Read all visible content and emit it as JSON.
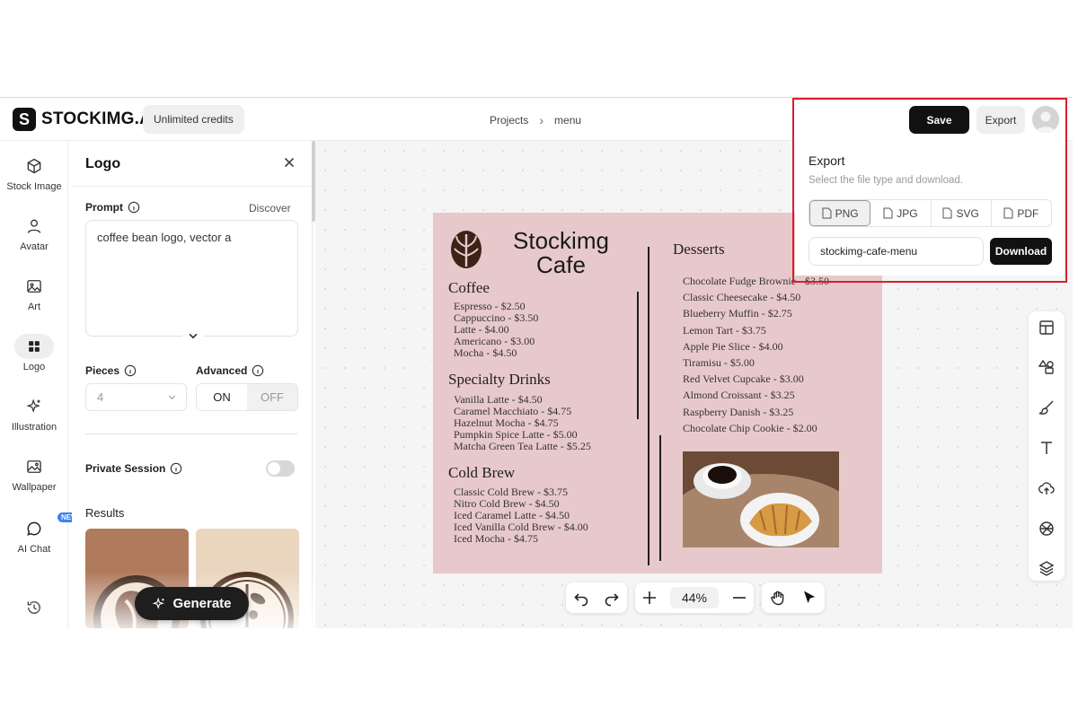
{
  "header": {
    "brand": "STOCKIMG.AI",
    "credits": "Unlimited credits",
    "breadcrumb": [
      "Projects",
      "menu"
    ],
    "save_label": "Save",
    "export_label": "Export"
  },
  "leftnav": {
    "items": [
      {
        "label": "Stock Image",
        "icon": "cube-icon"
      },
      {
        "label": "Avatar",
        "icon": "person-icon"
      },
      {
        "label": "Art",
        "icon": "image-icon"
      },
      {
        "label": "Logo",
        "icon": "grid-icon",
        "active": true
      },
      {
        "label": "Illustration",
        "icon": "sparkle-icon"
      },
      {
        "label": "Wallpaper",
        "icon": "wallpaper-icon"
      },
      {
        "label": "AI Chat",
        "icon": "chat-icon",
        "badge": "NEW"
      }
    ],
    "history_icon": "history-icon"
  },
  "panel": {
    "title": "Logo",
    "prompt_label": "Prompt",
    "discover": "Discover",
    "prompt_value": "coffee bean logo, vector a",
    "pieces_label": "Pieces",
    "pieces_value": "4",
    "advanced_label": "Advanced",
    "advanced_on": "ON",
    "advanced_off": "OFF",
    "private_label": "Private Session",
    "results_label": "Results",
    "generate_label": "Generate"
  },
  "menu": {
    "cafe_name_line1": "Stockimg",
    "cafe_name_line2": "Cafe",
    "sections": [
      {
        "title": "Coffee",
        "items": [
          "Espresso - $2.50",
          "Cappuccino - $3.50",
          "Latte - $4.00",
          "Americano - $3.00",
          "Mocha - $4.50"
        ]
      },
      {
        "title": "Specialty Drinks",
        "items": [
          "Vanilla Latte - $4.50",
          "Caramel Macchiato - $4.75",
          "Hazelnut Mocha - $4.75",
          "Pumpkin Spice Latte - $5.00",
          "Matcha Green Tea Latte - $5.25"
        ]
      },
      {
        "title": "Cold Brew",
        "items": [
          "Classic Cold Brew - $3.75",
          "Nitro Cold Brew - $4.50",
          "Iced Caramel Latte - $4.50",
          "Iced Vanilla Cold Brew - $4.00",
          "Iced Mocha - $4.75"
        ]
      }
    ],
    "desserts_title": "Desserts",
    "desserts": [
      "Chocolate Fudge Brownie - $3.50",
      "Classic Cheesecake - $4.50",
      "Blueberry Muffin - $2.75",
      "Lemon Tart - $3.75",
      "Apple Pie Slice - $4.00",
      "Tiramisu - $5.00",
      "Red Velvet Cupcake - $3.00",
      "Almond Croissant - $3.25",
      "Raspberry Danish - $3.25",
      "Chocolate Chip Cookie - $2.00"
    ]
  },
  "toolbar": {
    "zoom": "44%"
  },
  "export": {
    "title": "Export",
    "subtitle": "Select the file type and download.",
    "types": [
      "PNG",
      "JPG",
      "SVG",
      "PDF"
    ],
    "selected": "PNG",
    "filename": "stockimg-cafe-menu",
    "download_label": "Download"
  },
  "colors": {
    "artboard": "#e8c9cb",
    "accent_dark": "#111111",
    "highlight": "#d6202e"
  }
}
